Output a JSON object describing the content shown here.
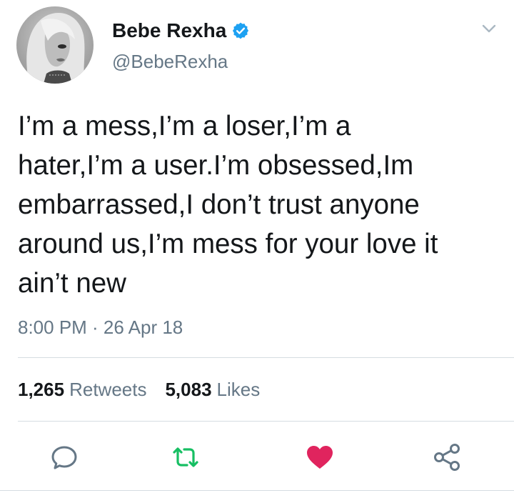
{
  "author": {
    "display_name": "Bebe Rexha",
    "handle": "@BebeRexha",
    "verified": true
  },
  "tweet": {
    "text": "I’m a mess,I’m a loser,I’m a\nhater,I’m a user.I’m obsessed,Im\nembarrassed,I don’t trust anyone\naround us,I’m mess for your love it\nain’t new",
    "timestamp": "8:00 PM · 26 Apr 18"
  },
  "stats": {
    "retweets_count": "1,265",
    "retweets_label": "Retweets",
    "likes_count": "5,083",
    "likes_label": "Likes"
  },
  "actions": [
    {
      "name": "reply",
      "icon": "reply-icon"
    },
    {
      "name": "retweet",
      "icon": "retweet-icon"
    },
    {
      "name": "like",
      "icon": "heart-icon",
      "active": true
    },
    {
      "name": "share",
      "icon": "share-icon"
    }
  ],
  "colors": {
    "verified_blue": "#1da1f2",
    "retweet_green": "#17bf63",
    "like_red": "#e0245e",
    "secondary_text": "#657786",
    "primary_text": "#14171a",
    "icon_gray": "#657786"
  }
}
